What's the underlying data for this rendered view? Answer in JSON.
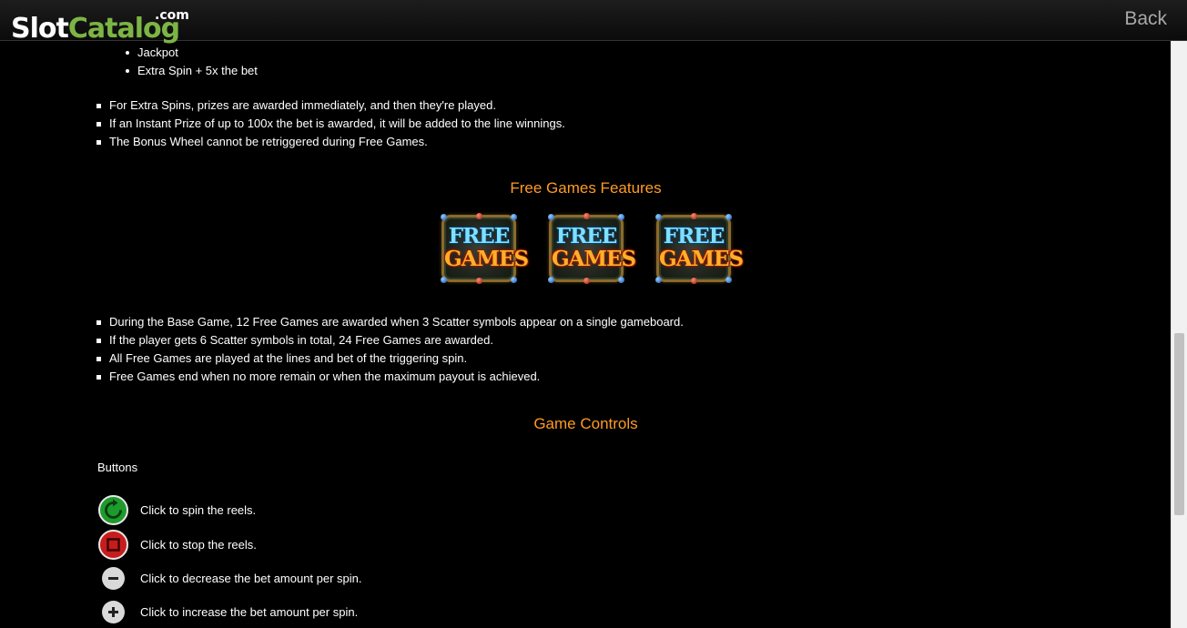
{
  "header": {
    "logo_slot": "Slot",
    "logo_catalog": "Catalog",
    "logo_com": ".com",
    "back_label": "Back"
  },
  "top_sublist": [
    "Jackpot",
    "Extra Spin + 5x the bet"
  ],
  "bonus_notes": [
    "For Extra Spins, prizes are awarded immediately, and then they're played.",
    "If an Instant Prize of up to 100x the bet is awarded, it will be added to the line winnings.",
    "The Bonus Wheel cannot be retriggered during Free Games."
  ],
  "free_games": {
    "title": "Free Games Features",
    "icons": [
      {
        "line1": "FREE",
        "line2": "GAMES"
      },
      {
        "line1": "FREE",
        "line2": "GAMES"
      },
      {
        "line1": "FREE",
        "line2": "GAMES"
      }
    ],
    "notes": [
      "During the Base Game, 12 Free Games are awarded when 3 Scatter symbols appear on a single gameboard.",
      "If the player gets 6 Scatter symbols in total, 24 Free Games are awarded.",
      "All Free Games are played at the lines and bet of the triggering spin.",
      "Free Games end when no more remain or when the maximum payout is achieved."
    ]
  },
  "game_controls": {
    "title": "Game Controls",
    "buttons_heading": "Buttons",
    "controls": [
      {
        "icon": "spin-icon",
        "text": "Click to spin the reels."
      },
      {
        "icon": "stop-icon",
        "text": "Click to stop the reels."
      },
      {
        "icon": "minus-icon",
        "text": "Click to decrease the bet amount per spin."
      },
      {
        "icon": "plus-icon",
        "text": "Click to increase the bet amount per spin."
      }
    ]
  },
  "colors": {
    "background": "#000000",
    "accent_title": "#ff9a24",
    "logo_green": "#7cb544",
    "spin_green": "#1f9a2c",
    "stop_red": "#c81c1c"
  }
}
